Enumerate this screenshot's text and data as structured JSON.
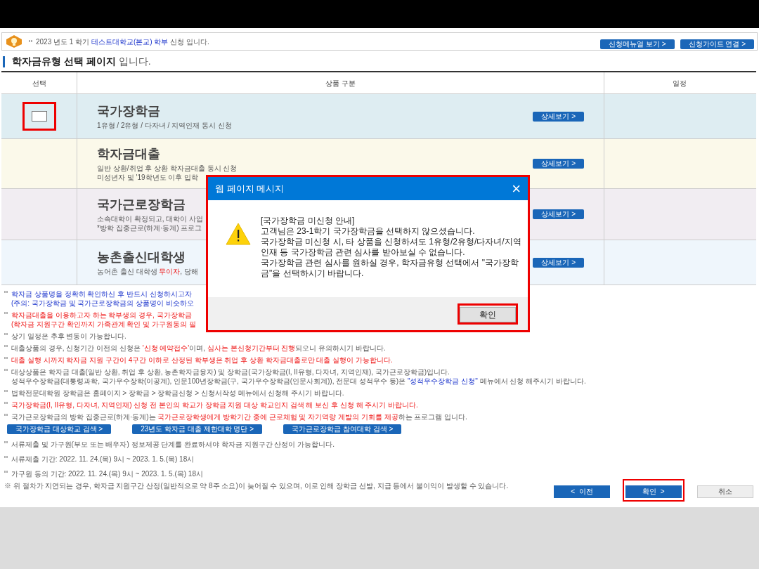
{
  "header": {
    "notice": {
      "text": "2023 년도 1 학기 **테스트대학교(본교) 학부** 신청 입니다.",
      "kind": "linked"
    },
    "buttons": [
      "신청메뉴얼 보기 >",
      "신청가이드 연결 >"
    ]
  },
  "page_title": {
    "bold": "학자금유형 선택 페이지",
    "rest": " 입니다."
  },
  "table": {
    "columns": [
      "선택",
      "상품 구분",
      "일정"
    ],
    "rows": [
      {
        "kind": "checkbox",
        "checked": false,
        "highlighted": true,
        "title": "국가장학금",
        "description": {
          "text": "1유형 / 2유형 / 다자녀 / 지역인재 동시 신청",
          "kind": "normal"
        },
        "button": "상세보기 >"
      },
      {
        "kind": "plain",
        "title": "학자금대출",
        "description": {
          "text": "일반 상환/취업 후 상환 학자금대출 동시 신청\n미성년자 및 '19학년도 이후 입학",
          "kind": "normal"
        },
        "button": "상세보기 >"
      },
      {
        "kind": "plain",
        "title": "국가근로장학금",
        "description": {
          "text": "소속대학이 확정되고, 대학이 사업\n*방학 집중근로(하계·동계) 프로그",
          "kind": "normal"
        },
        "button": "상세보기 >"
      },
      {
        "kind": "plain",
        "title": "농촌출신대학생",
        "description": {
          "text": "농어촌 출신 대학생 **무이자**, 당해",
          "kind": "normal"
        },
        "button": "상세보기 >"
      }
    ]
  },
  "notes": [
    {
      "text": "학자금 상품명을 정확히 확인하신 후 반드시 신청하시고자\n(주의: 국가장학금 및 국가근로장학금의 상품명이 비슷하오",
      "kind": "notice"
    },
    {
      "text": "학자금대출을 이용하고자 하는 학부생의 경우, 국가장학금\n(학자금 지원구간 확인까지 가족관계 확인 및 가구원동의 필",
      "kind": "warning"
    },
    {
      "text": "상기 일정은 추후 변동이 가능합니다.",
      "kind": "normal"
    },
    {
      "text": "대출상품의 경우, 신청기간 이전의 신청은 **'신청 예약접수'**이며, **심사는 본신청기간부터 진행**되오니 유의하시기 바랍니다.",
      "kind": "normal"
    },
    {
      "text": "대출 실행 시까지 학자금 지원 구간이 4구간 이하로 산정된 학부생은 취업 후 상환 학자금대출로만 대출 실행이 가능합니다.",
      "kind": "warning"
    },
    {
      "text": "대상상품은 학자금 대출(일반 상환, 취업 후 상환, 농촌학자금융자) 및 장학금(국가장학금(I, II유형, 다자녀, 지역인재), 국가근로장학금)입니다.\n성적우수장학금(대통령과학, 국가우수장학(이공계), 인문100년장학금(구, 국가우수장학금(인문사회계)), 전문대 성적우수 등)은 **\"성적우수장학금 신청\"** 메뉴에서 신청 해주시기 바랍니다.",
      "kind": "linked"
    },
    {
      "text": "법학전문대학원 장학금은 홈페이지 > 장학금 > 장학금신청 > 신청서작성 메뉴에서 신청해 주시기 바랍니다.",
      "kind": "normal"
    },
    {
      "text": "국가장학금(I, II유형, 다자녀, 지역인재) 신청 전 본인의 학교가 장학금 지원 대상 학교인지 검색 해 보신 후 신청 해 주시기 바랍니다.",
      "kind": "warning"
    },
    {
      "text": "국가근로장학금의 방학 집중근로(하계·동계)는 **국가근로장학생에게 방학기간 중에 근로체험 및 자기역량 계발의 기회를 제공**하는 프로그램 입니다.",
      "kind": "normal"
    }
  ],
  "search_buttons": [
    "국가장학금 대상학교 검색 >",
    "23년도 학자금 대출 제한대학 명단 >",
    "국가근로장학금 참여대학 검색 >"
  ],
  "notes2": [
    {
      "text": "서류제출 및 가구원(부모 또는 배우자) 정보제공 단계를 완료하셔야 학자금 지원구간 산정이 가능합니다."
    },
    {
      "text": "서류제출 기간: 2022. 11. 24.(목) 9시 ~ 2023. 1. 5.(목) 18시"
    },
    {
      "text": "가구원 동의 기간: 2022. 11. 24.(목) 9시 ~ 2023. 1. 5.(목) 18시"
    }
  ],
  "warning_note": "※ 위 절차가 지연되는 경우, 학자금 지원구간 산정(일반적으로 약 8주 소요)이 늦어질 수 있으며, 이로 인해 장학금 선발, 지급 등에서 불이익이 발생할 수 있습니다.",
  "footer_buttons": [
    {
      "label": "<  이전",
      "kind": "primary",
      "highlighted": false
    },
    {
      "label": "확인  >",
      "kind": "primary",
      "highlighted": true
    },
    {
      "label": "취소",
      "kind": "secondary",
      "highlighted": false
    }
  ],
  "dialog": {
    "title": "웹 페이지 메시지",
    "close": "×",
    "message": "[국가장학금 미신청 안내]\n고객님은 23-1학기 국가장학금을 선택하지 않으셨습니다.\n국가장학금 미신청 시, 타 상품을 신청하셔도 1유형/2유형/다자녀/지역인재 등 국가장학금 관련 심사를 받아보실 수 없습니다.\n국가장학금 관련 심사를 원하실 경우, 학자금유형 선택에서 \"국가장학금\"을 선택하시기 바랍니다.",
    "button": "확인",
    "highlighted": true
  }
}
